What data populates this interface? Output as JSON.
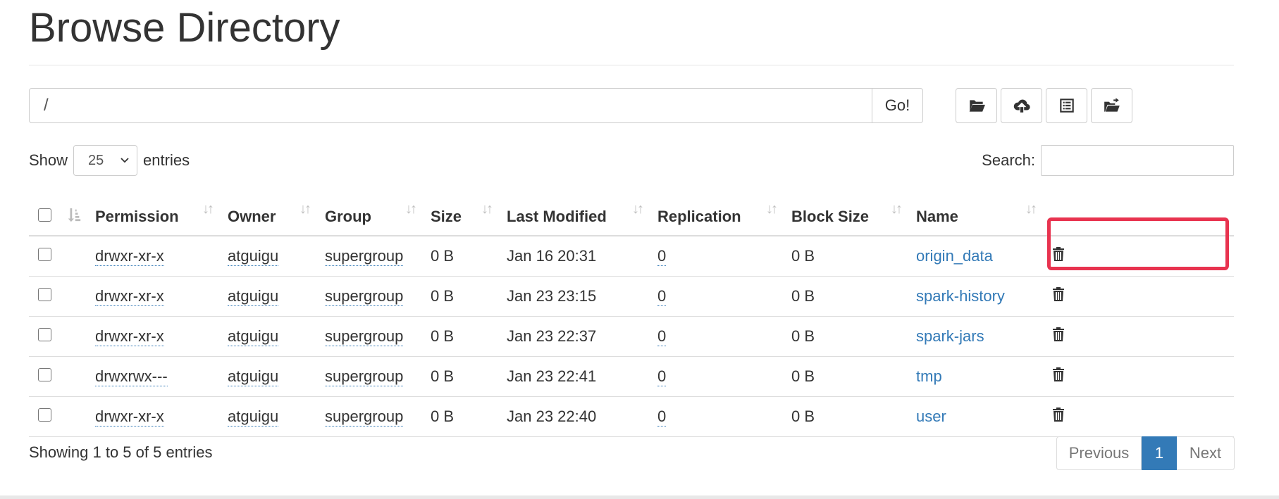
{
  "page": {
    "title": "Browse Directory"
  },
  "path_bar": {
    "value": "/",
    "go_label": "Go!"
  },
  "toolbar": {
    "buttons": [
      {
        "icon": "folder-open-icon"
      },
      {
        "icon": "cloud-upload-icon"
      },
      {
        "icon": "list-alt-icon"
      },
      {
        "icon": "folder-move-icon"
      }
    ]
  },
  "length": {
    "show_label": "Show",
    "selected": "25",
    "entries_label": "entries"
  },
  "search": {
    "label": "Search:",
    "value": ""
  },
  "table": {
    "columns": [
      "Permission",
      "Owner",
      "Group",
      "Size",
      "Last Modified",
      "Replication",
      "Block Size",
      "Name"
    ],
    "rows": [
      {
        "permission": "drwxr-xr-x",
        "owner": "atguigu",
        "group": "supergroup",
        "size": "0 B",
        "modified": "Jan 16 20:31",
        "replication": "0",
        "block_size": "0 B",
        "name": "origin_data"
      },
      {
        "permission": "drwxr-xr-x",
        "owner": "atguigu",
        "group": "supergroup",
        "size": "0 B",
        "modified": "Jan 23 23:15",
        "replication": "0",
        "block_size": "0 B",
        "name": "spark-history"
      },
      {
        "permission": "drwxr-xr-x",
        "owner": "atguigu",
        "group": "supergroup",
        "size": "0 B",
        "modified": "Jan 23 22:37",
        "replication": "0",
        "block_size": "0 B",
        "name": "spark-jars"
      },
      {
        "permission": "drwxrwx---",
        "owner": "atguigu",
        "group": "supergroup",
        "size": "0 B",
        "modified": "Jan 23 22:41",
        "replication": "0",
        "block_size": "0 B",
        "name": "tmp"
      },
      {
        "permission": "drwxr-xr-x",
        "owner": "atguigu",
        "group": "supergroup",
        "size": "0 B",
        "modified": "Jan 23 22:40",
        "replication": "0",
        "block_size": "0 B",
        "name": "user"
      }
    ]
  },
  "footer": {
    "info": "Showing 1 to 5 of 5 entries"
  },
  "pagination": {
    "previous": "Previous",
    "current": "1",
    "next": "Next"
  },
  "colors": {
    "link": "#337ab7",
    "highlight": "#e8334f",
    "active_page": "#337ab7"
  }
}
